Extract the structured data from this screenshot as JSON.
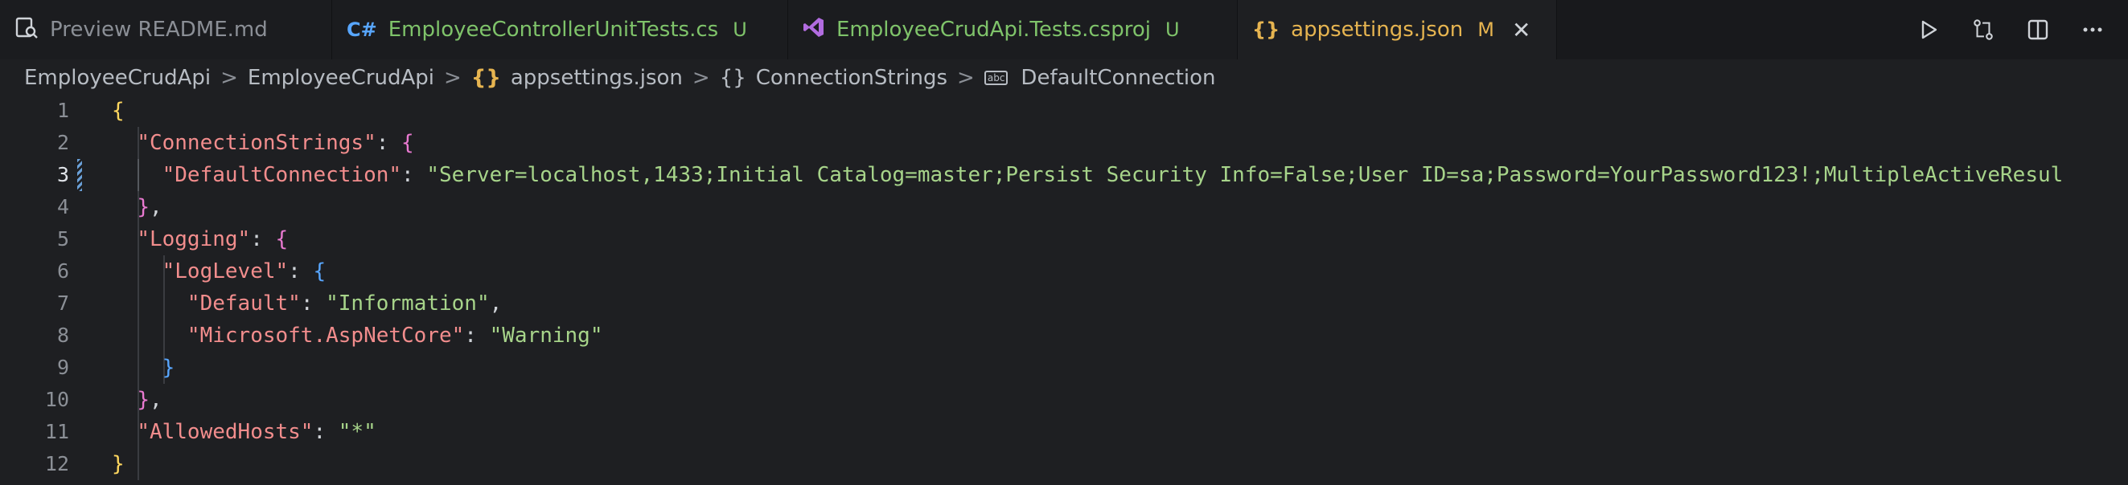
{
  "tabs": [
    {
      "label": "Preview README.md",
      "icon": "preview-icon",
      "badge": "",
      "active": false
    },
    {
      "label": "EmployeeControllerUnitTests.cs",
      "icon": "csharp-icon",
      "badge": "U",
      "active": false
    },
    {
      "label": "EmployeeCrudApi.Tests.csproj",
      "icon": "visual-studio-icon",
      "badge": "U",
      "active": false
    },
    {
      "label": "appsettings.json",
      "icon": "json-braces-icon",
      "badge": "M",
      "active": true
    }
  ],
  "actions": [
    "run-icon",
    "compare-changes-icon",
    "split-editor-icon",
    "more-actions-icon"
  ],
  "breadcrumb": {
    "seg1": "EmployeeCrudApi",
    "seg2": "EmployeeCrudApi",
    "file_icon": "{}",
    "seg3": "appsettings.json",
    "obj_icon": "{}",
    "seg4": "ConnectionStrings",
    "str_icon": "abc",
    "seg5": "DefaultConnection",
    "sep": ">"
  },
  "editor": {
    "line_numbers": [
      "1",
      "2",
      "3",
      "4",
      "5",
      "6",
      "7",
      "8",
      "9",
      "10",
      "11",
      "12"
    ],
    "current_line": "3",
    "tokens": {
      "l1_brace": "{",
      "l2_key": "\"ConnectionStrings\"",
      "l2_punc": ": ",
      "l2_brace": "{",
      "l3_key": "\"DefaultConnection\"",
      "l3_punc": ": ",
      "l3_val": "\"Server=localhost,1433;Initial Catalog=master;Persist Security Info=False;User ID=sa;Password=YourPassword123!;MultipleActiveResul",
      "l4_brace": "}",
      "l4_punc": ",",
      "l5_key": "\"Logging\"",
      "l5_punc": ": ",
      "l5_brace": "{",
      "l6_key": "\"LogLevel\"",
      "l6_punc": ": ",
      "l6_brace": "{",
      "l7_key": "\"Default\"",
      "l7_punc": ": ",
      "l7_val": "\"Information\"",
      "l7_comma": ",",
      "l8_key": "\"Microsoft.AspNetCore\"",
      "l8_punc": ": ",
      "l8_val": "\"Warning\"",
      "l9_brace": "}",
      "l10_brace": "}",
      "l10_punc": ",",
      "l11_key": "\"AllowedHosts\"",
      "l11_punc": ": ",
      "l11_val": "\"*\"",
      "l12_brace": "}"
    }
  },
  "colors": {
    "background": "#1e1f22",
    "active_tab_text": "#e6b450",
    "string_value": "#a7d48a",
    "json_key": "#f28d8d",
    "untracked_badge": "#7fc36a",
    "modified_badge": "#e6b450"
  }
}
